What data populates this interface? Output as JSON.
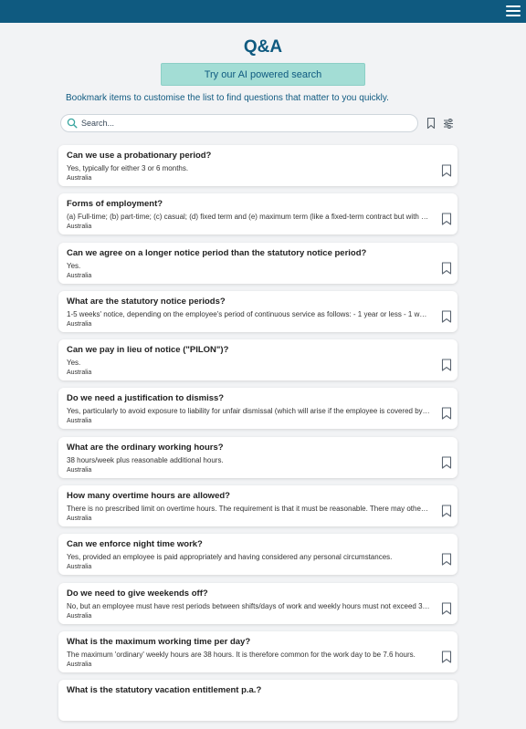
{
  "header": {
    "menu_icon": "hamburger-menu-icon"
  },
  "page": {
    "title": "Q&A",
    "ai_search_label": "Try our AI powered search",
    "hint": "Bookmark items to customise the list to find questions that matter to you quickly."
  },
  "search": {
    "placeholder": "Search...",
    "value": ""
  },
  "colors": {
    "primary": "#0f5a80",
    "accent": "#a3ddd5",
    "background": "#f2f3f5"
  },
  "items": [
    {
      "question": "Can we use a probationary period?",
      "answer": "Yes, typically for either 3 or 6 months.",
      "country": "Australia"
    },
    {
      "question": "Forms of employment?",
      "answer": "(a) Full-time; (b) part-time; (c) casual; (d) fixed term and (e) maximum term (like a fixed-term contract but with the a...",
      "country": "Australia"
    },
    {
      "question": "Can we agree on a longer notice period than the statutory notice period?",
      "answer": "Yes.",
      "country": "Australia"
    },
    {
      "question": "What are the statutory notice periods?",
      "answer": "1-5 weeks' notice, depending on the employee's period of continuous service as follows: - 1 year or less - 1 week - ...",
      "country": "Australia"
    },
    {
      "question": "Can we pay in lieu of notice (\"PILON\")?",
      "answer": "Yes.",
      "country": "Australia"
    },
    {
      "question": "Do we need a justification to dismiss?",
      "answer": "Yes, particularly to avoid exposure to liability for unfair dismissal (which will arise if the employee is covered by a m...",
      "country": "Australia"
    },
    {
      "question": "What are the ordinary working hours?",
      "answer": "38 hours/week plus reasonable additional hours.",
      "country": "Australia"
    },
    {
      "question": "How many overtime hours are allowed?",
      "answer": "There is no prescribed limit on overtime hours. The requirement is that it must be reasonable. There may otherwise...",
      "country": "Australia"
    },
    {
      "question": "Can we enforce night time work?",
      "answer": "Yes, provided an employee is paid appropriately and having considered any personal circumstances.",
      "country": "Australia"
    },
    {
      "question": "Do we need to give weekends off?",
      "answer": "No, but an employee must have rest periods between shifts/days of work and weekly hours must not exceed 38 pl...",
      "country": "Australia"
    },
    {
      "question": "What is the maximum working time per day?",
      "answer": "The maximum 'ordinary' weekly hours are 38 hours. It is therefore common for the work day to be 7.6 hours.",
      "country": "Australia"
    },
    {
      "question": "What is the statutory vacation entitlement p.a.?",
      "answer": "",
      "country": ""
    }
  ]
}
